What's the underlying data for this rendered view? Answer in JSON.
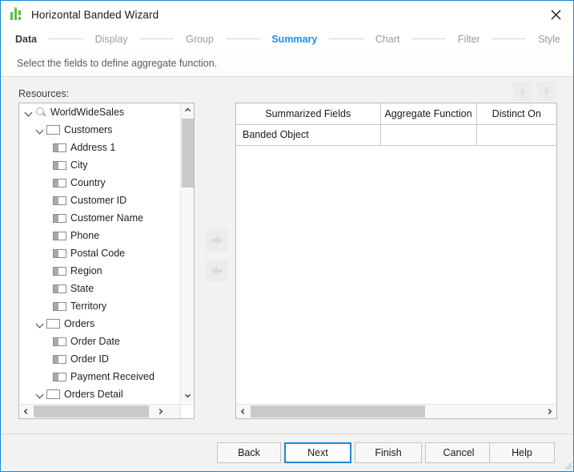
{
  "window": {
    "title": "Horizontal Banded Wizard",
    "icon": "bar-chart-icon",
    "close_icon": "close-icon",
    "accent_color": "#1e88d6",
    "brand_green": "#62bb46"
  },
  "steps": [
    {
      "label": "Data",
      "state": "done"
    },
    {
      "label": "Display",
      "state": "pending"
    },
    {
      "label": "Group",
      "state": "pending"
    },
    {
      "label": "Summary",
      "state": "active"
    },
    {
      "label": "Chart",
      "state": "pending"
    },
    {
      "label": "Filter",
      "state": "pending"
    },
    {
      "label": "Style",
      "state": "pending"
    }
  ],
  "instruction": "Select the fields to define aggregate function.",
  "resources": {
    "label": "Resources:",
    "tree": [
      {
        "label": "WorldWideSales",
        "level": 0,
        "icon": "query-icon",
        "expander": "chevron-down-icon"
      },
      {
        "label": "Customers",
        "level": 1,
        "icon": "table-icon",
        "expander": "chevron-down-icon"
      },
      {
        "label": "Address 1",
        "level": 2,
        "icon": "field-icon",
        "expander": "none"
      },
      {
        "label": "City",
        "level": 2,
        "icon": "field-icon",
        "expander": "none"
      },
      {
        "label": "Country",
        "level": 2,
        "icon": "field-icon",
        "expander": "none"
      },
      {
        "label": "Customer ID",
        "level": 2,
        "icon": "field-icon",
        "expander": "none"
      },
      {
        "label": "Customer Name",
        "level": 2,
        "icon": "field-icon",
        "expander": "none"
      },
      {
        "label": "Phone",
        "level": 2,
        "icon": "field-icon",
        "expander": "none"
      },
      {
        "label": "Postal Code",
        "level": 2,
        "icon": "field-icon",
        "expander": "none"
      },
      {
        "label": "Region",
        "level": 2,
        "icon": "field-icon",
        "expander": "none"
      },
      {
        "label": "State",
        "level": 2,
        "icon": "field-icon",
        "expander": "none"
      },
      {
        "label": "Territory",
        "level": 2,
        "icon": "field-icon",
        "expander": "none"
      },
      {
        "label": "Orders",
        "level": 1,
        "icon": "table-icon",
        "expander": "chevron-down-icon"
      },
      {
        "label": "Order Date",
        "level": 2,
        "icon": "field-icon",
        "expander": "none"
      },
      {
        "label": "Order ID",
        "level": 2,
        "icon": "field-icon",
        "expander": "none"
      },
      {
        "label": "Payment Received",
        "level": 2,
        "icon": "field-icon",
        "expander": "none"
      },
      {
        "label": "Orders Detail",
        "level": 1,
        "icon": "table-icon",
        "expander": "chevron-down-icon"
      }
    ]
  },
  "transfer": {
    "add_icon": "arrow-right-icon",
    "remove_icon": "arrow-left-icon",
    "add_enabled": false,
    "remove_enabled": false
  },
  "order": {
    "up_icon": "arrow-up-icon",
    "down_icon": "arrow-down-icon",
    "up_enabled": false,
    "down_enabled": false
  },
  "grid": {
    "columns": [
      "Summarized Fields",
      "Aggregate Function",
      "Distinct On"
    ],
    "rows": [
      {
        "summarized_field": "Banded Object",
        "aggregate_function": "",
        "distinct_on": ""
      }
    ]
  },
  "scrollbars": {
    "tree_v_up_icon": "chevron-up-icon",
    "tree_v_down_icon": "chevron-down-icon",
    "tree_h_left_icon": "chevron-left-icon",
    "tree_h_right_icon": "chevron-right-icon",
    "grid_h_left_icon": "chevron-left-icon",
    "grid_h_right_icon": "chevron-right-icon"
  },
  "footer": {
    "back": "Back",
    "next": "Next",
    "finish": "Finish",
    "cancel": "Cancel",
    "help": "Help"
  }
}
